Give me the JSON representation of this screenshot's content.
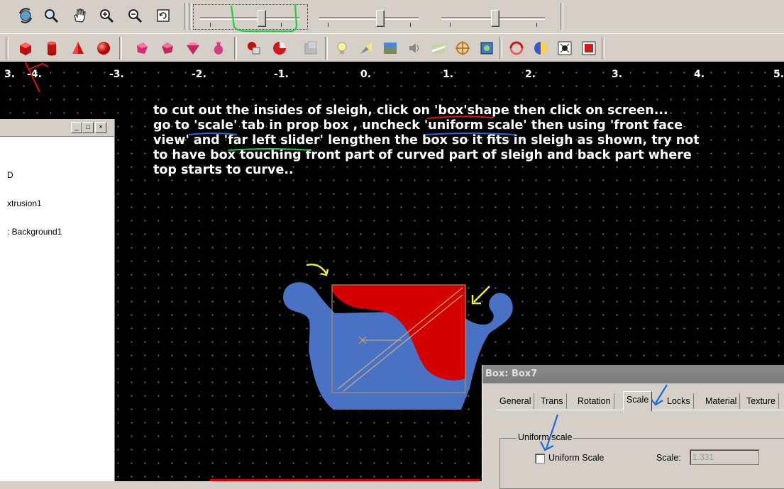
{
  "toolbar_top": {
    "tools": [
      {
        "icon": "rotate-view-icon"
      },
      {
        "icon": "zoom-magnifier-icon"
      },
      {
        "icon": "pan-hand-icon"
      },
      {
        "icon": "zoom-in-icon"
      },
      {
        "icon": "zoom-out-icon"
      },
      {
        "icon": "fit-view-icon"
      }
    ],
    "sliders": [
      "slider-left",
      "slider-middle",
      "slider-right"
    ]
  },
  "toolbar_shapes": {
    "items": [
      "box-shape-icon",
      "cylinder-shape-icon",
      "cone-shape-icon",
      "sphere-shape-icon",
      "extrusion-icon",
      "polyhedron-icon",
      "gem-icon",
      "vase-icon",
      "group-icon",
      "inline-icon",
      "disabled-shape-icon",
      "light-bulb-icon",
      "spotlight-icon",
      "background-icon",
      "sound-icon",
      "fog-icon",
      "navigation-icon",
      "viewpoint-icon",
      "animation-icon",
      "globe-icon",
      "script-icon",
      "texture-icon"
    ]
  },
  "axis_labels": [
    "-4.",
    "-3.",
    "-2.",
    "-1.",
    "0.",
    "1.",
    "2.",
    "3.",
    "4.",
    "5."
  ],
  "left_edge_label": "3.",
  "instructions": {
    "line1": "to cut out the insides of sleigh, click on 'box'shape then click on screen...",
    "line2": "go to 'scale' tab in prop box , uncheck 'uniform scale' then using 'front face",
    "line3": "view' and 'far left slider' lengthen the box so it fits in sleigh as shown, try not",
    "line4": "to have box touching front part of curved part of sleigh and back part where",
    "line5": "top starts to curve.."
  },
  "scene_panel": {
    "buttons": [
      "_",
      "□",
      "×"
    ],
    "items": [
      "D",
      "xtrusion1",
      ": Background1"
    ]
  },
  "prop_box": {
    "title": "Box: Box7",
    "tabs": [
      "General",
      "Trans",
      "Rotation",
      "Scale",
      "Locks",
      "Material",
      "Texture"
    ],
    "active_tab": "Scale",
    "group_label": "Uniform scale",
    "checkbox_label": "Uniform Scale",
    "checkbox_checked": false,
    "scale_label": "Scale:",
    "scale_value": "1.331"
  },
  "colors": {
    "viewport_bg": "#000000",
    "sleigh": "#4a72c4",
    "box": "#d40000",
    "annotation_red": "#e01010",
    "annotation_blue": "#1a6ae0",
    "annotation_green": "#22cc44",
    "annotation_yellow": "#f0f040"
  }
}
